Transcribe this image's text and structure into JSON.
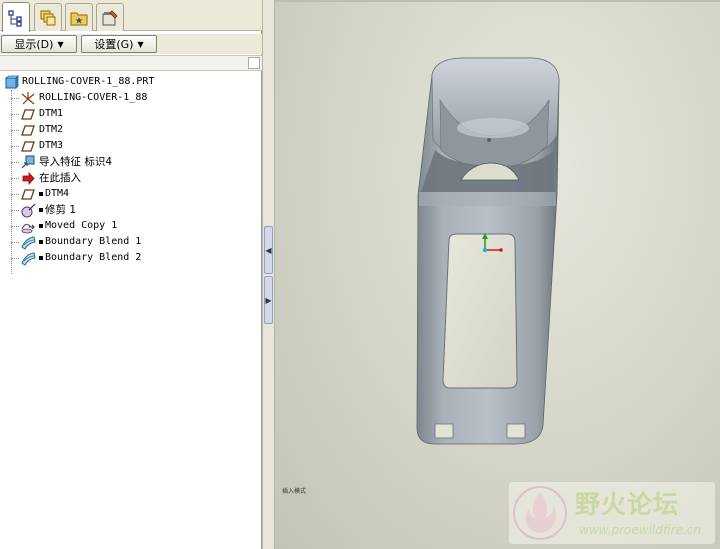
{
  "tabs": [
    {
      "icon": "model-tree-icon",
      "active": true
    },
    {
      "icon": "layers-icon",
      "active": false
    },
    {
      "icon": "folder-icon",
      "active": false
    },
    {
      "icon": "tools-icon",
      "active": false
    }
  ],
  "menus": {
    "display_label": "显示",
    "display_key": "(D)",
    "settings_label": "设置",
    "settings_key": "(G)"
  },
  "tree": {
    "items": [
      {
        "label": "ROLLING-COVER-1_88.PRT",
        "icon": "part-icon",
        "marked": false
      },
      {
        "label": "ROLLING-COVER-1_88",
        "icon": "csys-icon",
        "marked": false
      },
      {
        "label": "DTM1",
        "icon": "datum-plane-icon",
        "marked": false
      },
      {
        "label": "DTM2",
        "icon": "datum-plane-icon",
        "marked": false
      },
      {
        "label": "DTM3",
        "icon": "datum-plane-icon",
        "marked": false
      },
      {
        "label": "导入特征 标识4",
        "icon": "import-feature-icon",
        "marked": false
      },
      {
        "label": "在此插入",
        "icon": "insert-arrow-icon",
        "marked": false
      },
      {
        "label": "DTM4",
        "icon": "datum-plane-icon",
        "marked": true
      },
      {
        "label": "修剪 1",
        "icon": "trim-icon",
        "marked": true
      },
      {
        "label": "Moved Copy 1",
        "icon": "move-copy-icon",
        "marked": true
      },
      {
        "label": "Boundary Blend 1",
        "icon": "boundary-blend-icon",
        "marked": true
      },
      {
        "label": "Boundary Blend 2",
        "icon": "boundary-blend-icon",
        "marked": true
      }
    ]
  },
  "viewport": {
    "status_text": "插入模式",
    "watermark_title": "野火论坛",
    "watermark_url": "www.proewildfire.cn",
    "background_color": "#d7d8cb",
    "model_color": "#9aa2aa"
  }
}
